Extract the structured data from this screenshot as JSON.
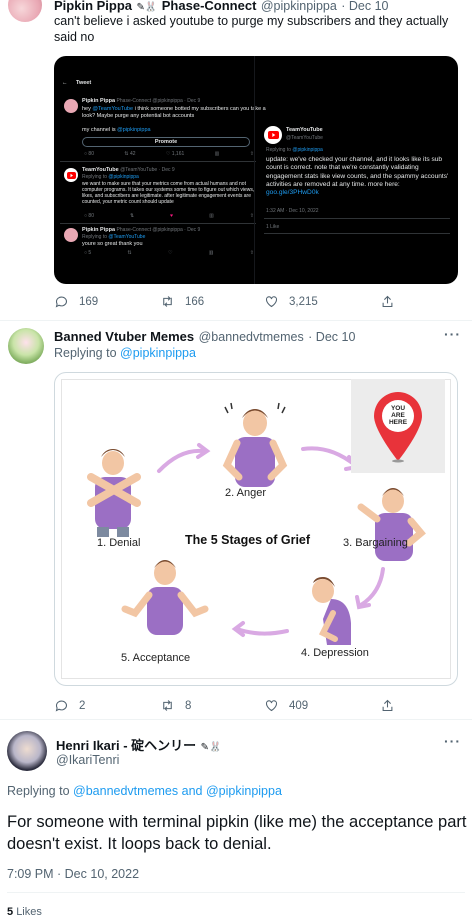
{
  "tweet1": {
    "name": "Pipkin Pippa",
    "name_suffix": "Phase-Connect",
    "handle": "@pipkinpippa",
    "date": "· Dec 10",
    "text": "can't believe i asked youtube to purge my subscribers and they actually said no",
    "replies": "169",
    "retweets": "166",
    "likes": "3,215",
    "embedded": {
      "header": "Tweet",
      "t1_name": "Pipkin Pippa",
      "t1_meta": "Phase-Connect @pipkinpippa · Dec 9",
      "t1_text_a": "hey",
      "t1_mention": "@TeamYouTube",
      "t1_text_b": "i think someone botted my subscribers can you take a look? Maybe purge any potential bot accounts",
      "t1_channel_prefix": "my channel is",
      "t1_channel_link": "@pipkinpippa",
      "promote": "Promote",
      "t2_name": "TeamYouTube",
      "t2_meta": "@TeamYouTube · Dec 9",
      "t2_reply_prefix": "Replying to",
      "t2_reply_link": "@pipkinpippa",
      "t2_text": "we want to make sure that your metrics come from actual humans and not computer programs. It takes our systems some time to figure out which views, likes, and subscribers are legitimate. after legitimate engagement events are counted, your metric count should update",
      "t3_name": "Pipkin Pippa",
      "t3_meta": "Phase-Connect @pipkinpippa · Dec 9",
      "t3_reply_prefix": "Replying to",
      "t3_reply_link": "@TeamYouTube",
      "t3_text": "youre so great thank you",
      "r_name": "TeamYouTube",
      "r_handle": "@TeamYouTube",
      "r_reply_prefix": "Replying to",
      "r_reply_link": "@pipkinpippa",
      "r_text": "update: we've checked your channel, and it looks like its sub count is correct. note that we're constantly validating engagement stats like view counts, and the spammy accounts' activities are removed at any time. more here:",
      "r_link": "goo.gle/3PHwD0k",
      "r_time": "1:32 AM · Dec 10, 2022",
      "r_likes": "1 Like"
    }
  },
  "tweet2": {
    "name": "Banned Vtuber Memes",
    "handle": "@bannedvtmemes",
    "date": "· Dec 10",
    "reply_prefix": "Replying to",
    "reply_link": "@pipkinpippa",
    "replies": "2",
    "retweets": "8",
    "likes": "409",
    "meme": {
      "title": "The 5 Stages of Grief",
      "stage1": "1. Denial",
      "stage2": "2. Anger",
      "stage3": "3. Bargaining",
      "stage4": "4. Depression",
      "stage5": "5. Acceptance",
      "pin_text": "YOU ARE HERE"
    }
  },
  "tweet3": {
    "name": "Henri Ikari - 碇ヘンリー",
    "handle": "@IkariTenri",
    "reply_prefix": "Replying to",
    "reply_link1": "@bannedvtmemes",
    "reply_and": "and",
    "reply_link2": "@pipkinpippa",
    "text": "For someone with terminal pipkin (like me) the acceptance part doesn't exist. It loops back to denial.",
    "time": "7:09 PM · Dec 10, 2022",
    "likes_count": "5",
    "likes_label": "Likes"
  },
  "colors": {
    "accent": "#1d9bf0",
    "muted": "#536471",
    "youtube": "#ff0000",
    "meme_purple": "#9b6fc4"
  }
}
